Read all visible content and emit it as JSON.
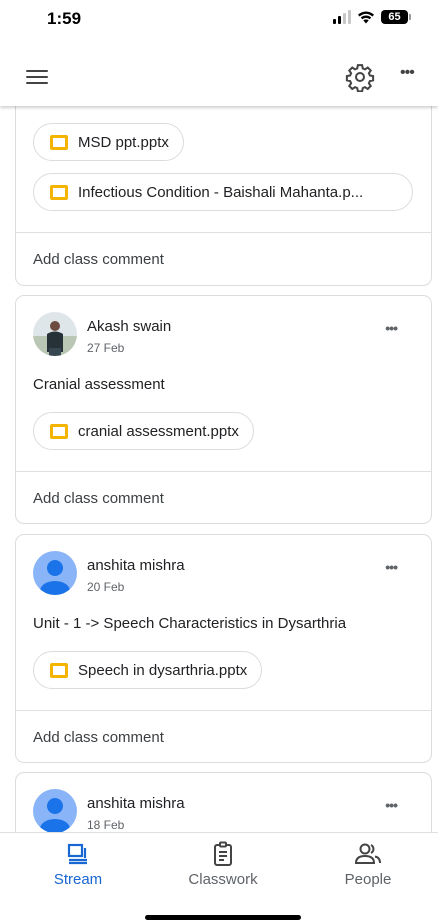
{
  "status": {
    "time": "1:59",
    "battery": "65"
  },
  "feed": {
    "post1": {
      "attachments": [
        "MSD ppt.pptx",
        "Infectious Condition - Baishali Mahanta.p..."
      ],
      "comment_label": "Add class comment"
    },
    "post2": {
      "author": "Akash swain",
      "date": "27 Feb",
      "text": "Cranial assessment",
      "attachments": [
        "cranial assessment.pptx"
      ],
      "comment_label": "Add class comment"
    },
    "post3": {
      "author": "anshita mishra",
      "date": "20 Feb",
      "text": "Unit - 1 -> Speech Characteristics in Dysarthria",
      "attachments": [
        "Speech in dysarthria.pptx"
      ],
      "comment_label": "Add class comment"
    },
    "post4": {
      "author": "anshita mishra",
      "date": "18 Feb"
    }
  },
  "nav": {
    "stream": "Stream",
    "classwork": "Classwork",
    "people": "People"
  },
  "colors": {
    "accent": "#1967d2",
    "slides": "#f4b400",
    "avatar_bg": "#8ab4f8",
    "avatar_fg": "#1a73e8"
  }
}
